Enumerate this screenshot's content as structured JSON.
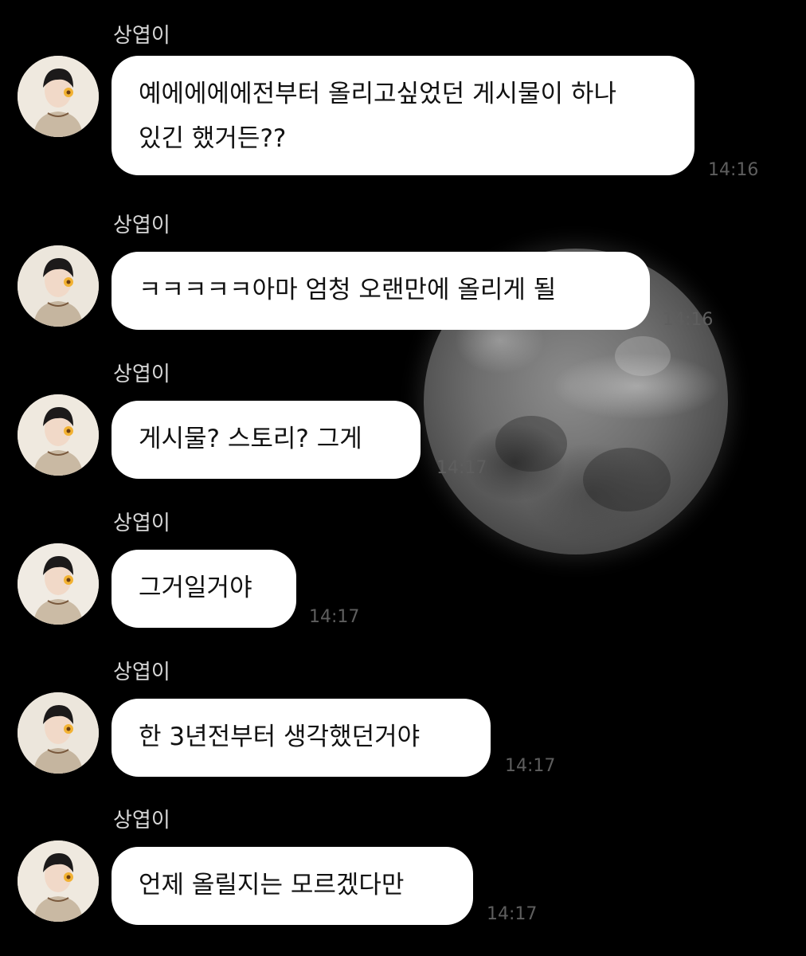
{
  "chat": {
    "messages": [
      {
        "sender": "상엽이",
        "text": "예에에에에전부터 올리고싶었던 게시물이 하나 있긴 했거든??",
        "time": "14:16"
      },
      {
        "sender": "상엽이",
        "text": "ㅋㅋㅋㅋㅋ아마 엄청 오랜만에 올리게 될",
        "time": "14:16"
      },
      {
        "sender": "상엽이",
        "text": "게시물? 스토리? 그게",
        "time": "14:17"
      },
      {
        "sender": "상엽이",
        "text": "그거일거야",
        "time": "14:17"
      },
      {
        "sender": "상엽이",
        "text": "한 3년전부터 생각했던거야",
        "time": "14:17"
      },
      {
        "sender": "상엽이",
        "text": "언제 올릴지는 모르겠다만",
        "time": "14:17"
      }
    ]
  },
  "colors": {
    "background": "#000000",
    "bubble": "#ffffff",
    "timestamp": "#5e5e5e",
    "sender": "#d8d8d8"
  },
  "icons": {
    "avatar": "profile-photo",
    "sticker": "sunflower-icon"
  }
}
